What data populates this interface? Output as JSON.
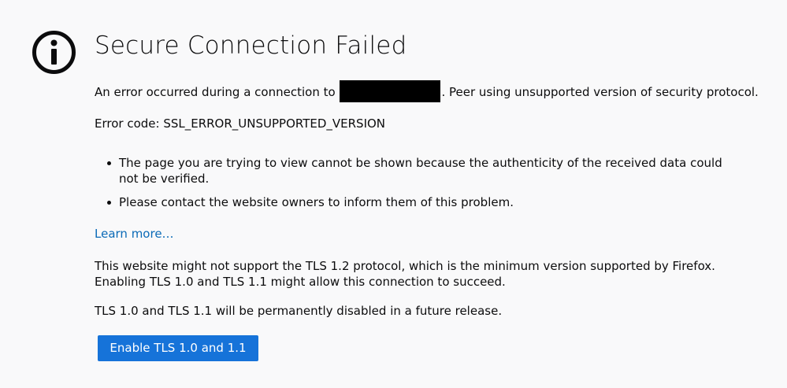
{
  "error_page": {
    "icon": "info-icon",
    "title": "Secure Connection Failed",
    "message_before": "An error occurred during a connection to",
    "message_after": ". Peer using unsupported version of security protocol.",
    "error_code": "Error code: SSL_ERROR_UNSUPPORTED_VERSION",
    "reasons": [
      "The page you are trying to view cannot be shown because the authenticity of the received data could not be verified.",
      "Please contact the website owners to inform them of this problem."
    ],
    "learn_more_label": "Learn more…",
    "tls_note": "This website might not support the TLS 1.2 protocol, which is the minimum version supported by Firefox. Enabling TLS 1.0 and TLS 1.1 might allow this connection to succeed.",
    "tls_future_note": "TLS 1.0 and TLS 1.1 will be permanently disabled in a future release.",
    "enable_button_label": "Enable TLS 1.0 and 1.1"
  },
  "colors": {
    "background": "#f9f9fa",
    "text": "#0c0c0d",
    "link": "#0a6ab7",
    "button": "#1673d9",
    "redaction": "#000000"
  }
}
